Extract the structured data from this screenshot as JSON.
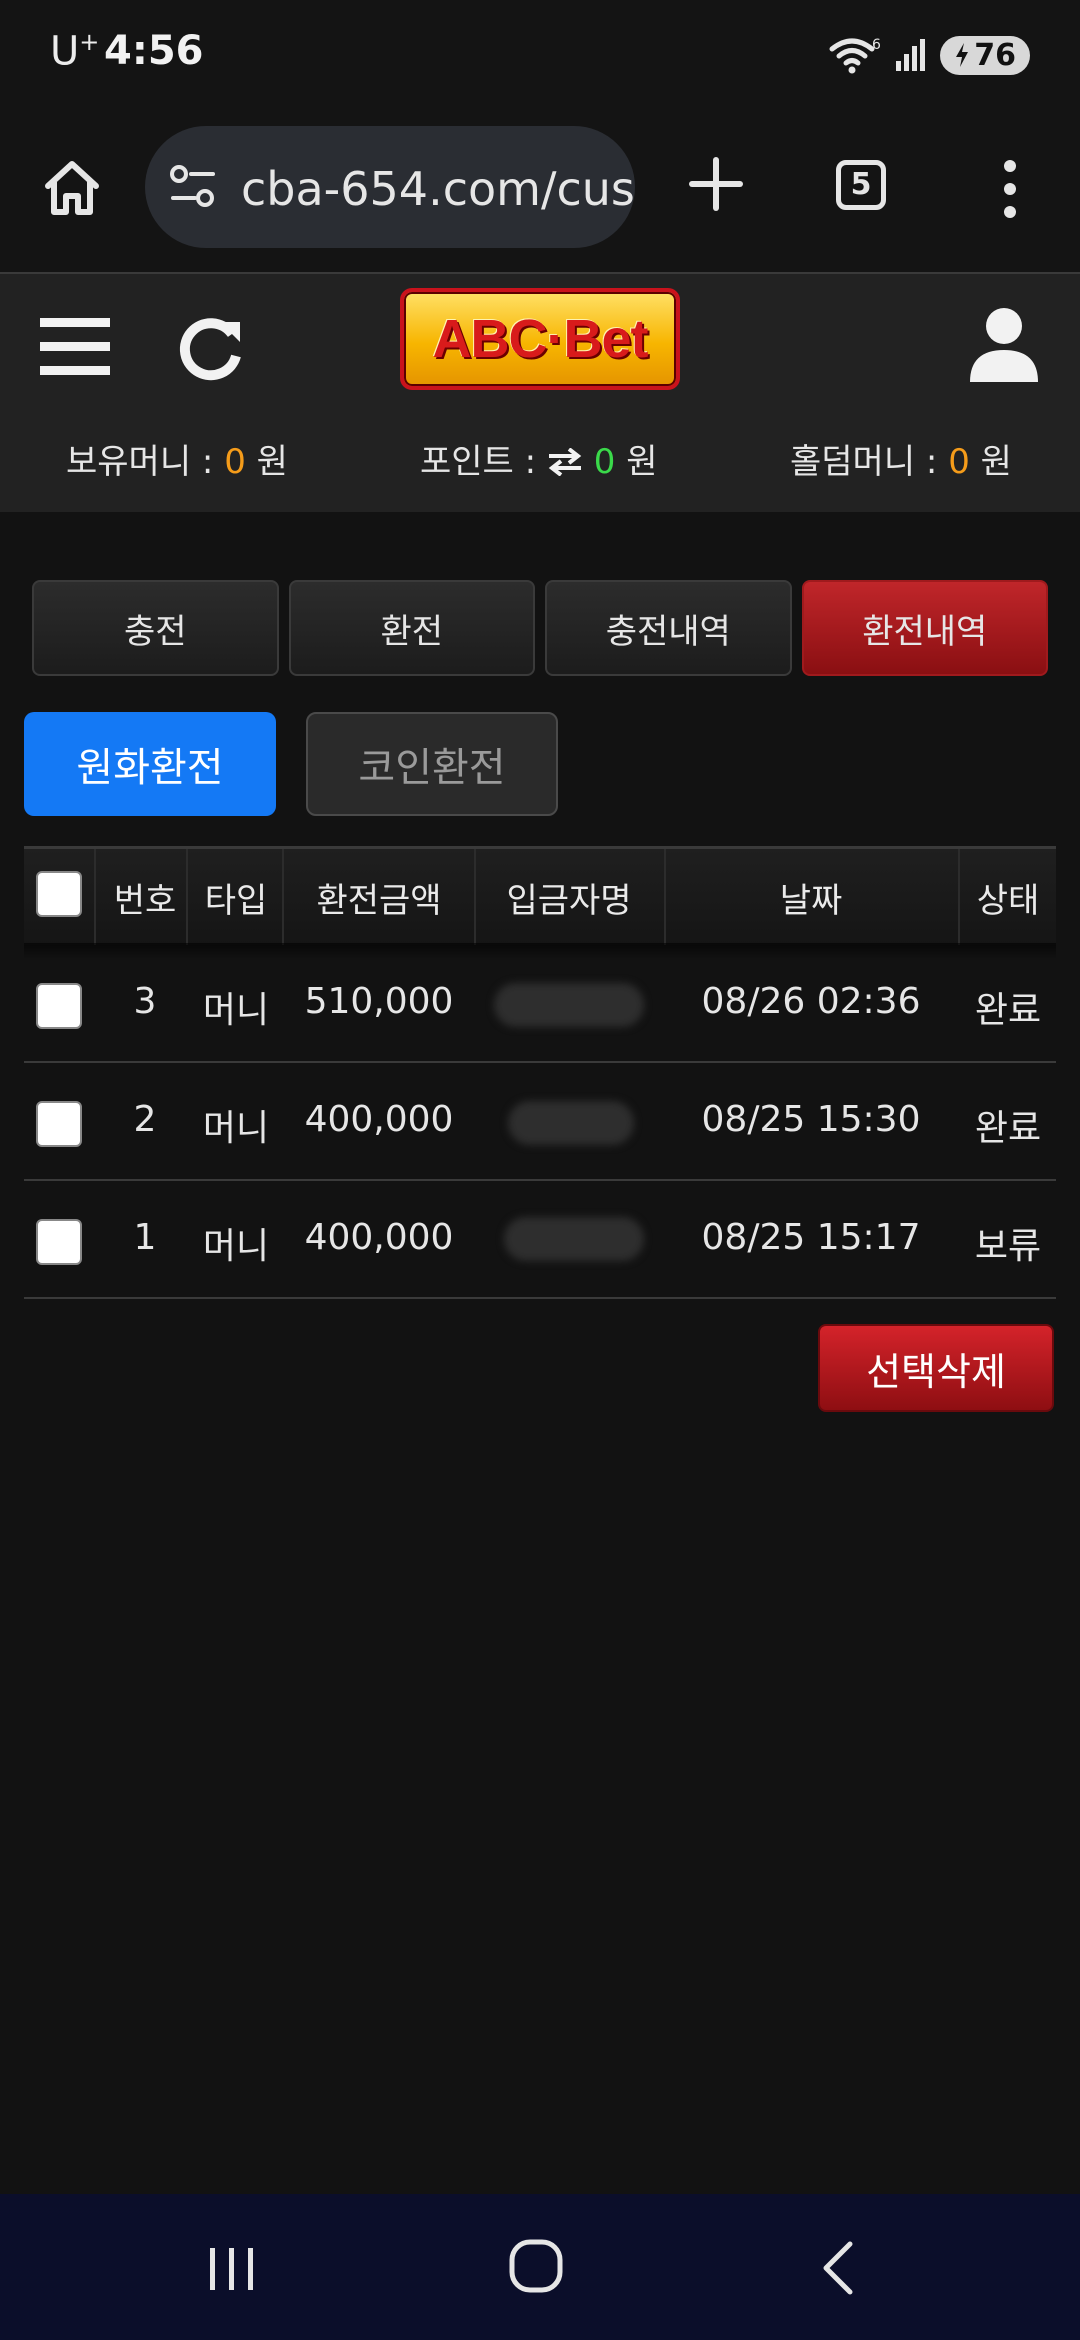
{
  "status_bar": {
    "carrier": "U",
    "carrier_sup": "+",
    "time": "4:56",
    "wifi_badge": "6",
    "battery": "76"
  },
  "browser": {
    "url": "cba-654.com/cus",
    "tab_count": "5"
  },
  "site": {
    "logo_text": "ABC·Bet",
    "balances": {
      "money_label": "보유머니 :",
      "money_value": "0",
      "money_unit": "원",
      "point_label": "포인트 :",
      "point_value": "0",
      "point_unit": "원",
      "holdem_label": "홀덤머니 :",
      "holdem_value": "0",
      "holdem_unit": "원"
    }
  },
  "tabs": [
    "충전",
    "환전",
    "충전내역",
    "환전내역"
  ],
  "active_tab_index": 3,
  "subtabs": [
    "원화환전",
    "코인환전"
  ],
  "table": {
    "headers": [
      "번호",
      "타입",
      "환전금액",
      "입금자명",
      "날짜",
      "상태"
    ],
    "rows": [
      {
        "no": "3",
        "type": "머니",
        "amount": "510,000",
        "date": "08/26 02:36",
        "status": "완료"
      },
      {
        "no": "2",
        "type": "머니",
        "amount": "400,000",
        "date": "08/25 15:30",
        "status": "완료"
      },
      {
        "no": "1",
        "type": "머니",
        "amount": "400,000",
        "date": "08/25 15:17",
        "status": "보류"
      }
    ]
  },
  "delete_label": "선택삭제",
  "colors": {
    "accent_red": "#c0262a",
    "accent_blue": "#1479f5",
    "orange": "#f59c1a",
    "green": "#3ad94a"
  }
}
